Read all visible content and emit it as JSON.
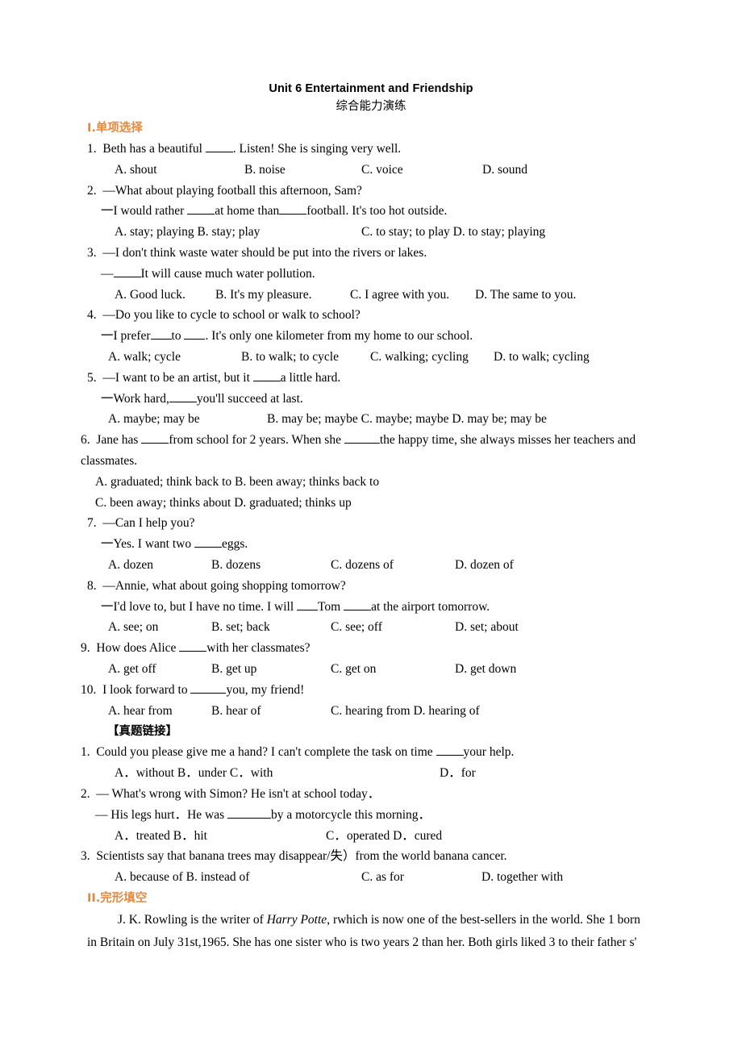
{
  "document": {
    "title": "Unit 6 Entertainment and Friendship",
    "subtitle": "综合能力演练",
    "accent_color": "#E8883A",
    "text_color": "#000000",
    "background": "#FFFFFF"
  },
  "sections": [
    {
      "id": "section-1",
      "numeral": "I.",
      "label": "单项选择",
      "heading_full": "I.单项选择"
    },
    {
      "id": "section-2",
      "numeral": "II.",
      "label": "完形填空",
      "heading_full": "II.完形填空"
    }
  ],
  "subheading": "【真题链接】",
  "multiple_choice": {
    "q1": {
      "number": "1.",
      "stem_1": "Beth has a beautiful ",
      "stem_2": ". Listen! She is singing very well.",
      "options": {
        "a": "A. shout",
        "b": "B. noise",
        "c": "C. voice",
        "d": "D. sound"
      }
    },
    "q2": {
      "number": "2.",
      "stem_1": "—What about playing football this afternoon, Sam?",
      "reply_1": "一I would rather ",
      "reply_2": "at home than",
      "reply_3": "football. It's too hot outside.",
      "options": {
        "ab": "A. stay; playing B. stay; play",
        "cd": "C. to stay; to play D. to stay; playing"
      }
    },
    "q3": {
      "number": "3.",
      "stem_1": "—I don't think waste water should be put into the rivers or lakes.",
      "reply_1": "—",
      "reply_2": "It will cause much water pollution.",
      "options": {
        "a": "A. Good luck.",
        "b": "B. It's my pleasure.",
        "c": "C. I agree with you.",
        "d": "D. The same to you."
      }
    },
    "q4": {
      "number": "4.",
      "stem_1": "—Do you like to cycle to school or walk to school?",
      "reply_1": "一I prefer",
      "reply_2": "to",
      "reply_3": ". It's only one kilometer from my home to our school.",
      "options": {
        "a": "A. walk; cycle",
        "b": "B. to walk; to cycle",
        "c": "C. walking; cycling",
        "d": "D. to walk; cycling"
      }
    },
    "q5": {
      "number": "5.",
      "stem_1": "—I want to be an artist, but it ",
      "stem_2": "a little hard.",
      "reply_1": "一Work hard,",
      "reply_2": "you'll succeed at last.",
      "options": {
        "a": "A. maybe; may be",
        "bcd": "B. may be; maybe C. maybe; maybe D. may be; may be"
      }
    },
    "q6": {
      "number": "6.",
      "stem_1": "Jane has ",
      "stem_2": "from school for 2 years. When she ",
      "stem_3": "the happy time, she always misses her teachers and classmates.",
      "options": {
        "ab": "A. graduated; think back to B. been away; thinks back to",
        "cd": "C. been away; thinks about D. graduated; thinks up"
      }
    },
    "q7": {
      "number": "7.",
      "stem_1": "—Can I help you?",
      "reply_1": "一Yes. I want two ",
      "reply_2": "eggs.",
      "options": {
        "a": "A. dozen",
        "b": "B. dozens",
        "c": "C. dozens of",
        "d": "D. dozen of"
      }
    },
    "q8": {
      "number": "8.",
      "stem_1": "—Annie, what about going shopping tomorrow?",
      "reply_1": "一I'd love to, but I have no time. I will ",
      "reply_2": "Tom ",
      "reply_3": "at the airport tomorrow.",
      "options": {
        "a": "A. see; on",
        "b": "B. set; back",
        "c": "C. see; off",
        "d": "D. set; about"
      }
    },
    "q9": {
      "number": "9.",
      "stem_1": "How does Alice ",
      "stem_2": "with her classmates?",
      "options": {
        "a": "A. get off",
        "b": "B. get up",
        "c": "C. get on",
        "d": "D. get down"
      }
    },
    "q10": {
      "number": "10.",
      "stem_1": "I look forward to ",
      "stem_2": "you, my friend!",
      "options": {
        "a": "A. hear from",
        "b": "B. hear of",
        "cd": "C. hearing from D. hearing of"
      }
    }
  },
  "exam_link": {
    "q1": {
      "number": "1.",
      "stem_1": "Could you please give me a hand? I can't complete the task on time ",
      "stem_2": "your help.",
      "options": {
        "abc": "A．without B．under C．with",
        "d": "D．for"
      }
    },
    "q2": {
      "number": "2.",
      "stem_1": "— What's wrong with Simon? He isn't at school today．",
      "reply_1": "— His legs hurt．He was ",
      "reply_2": "by a motorcycle this morning．",
      "options": {
        "ab": "A．treated B．hit",
        "cd": "C．operated D．cured"
      }
    },
    "q3": {
      "number": "3.",
      "stem_1": "Scientists say that banana trees may disappear/失）from the world banana cancer.",
      "options": {
        "ab": "A. because of B. instead of",
        "c": "C. as for",
        "d": "D. together with"
      }
    }
  },
  "cloze": {
    "line_1_pre": "J. K. Rowling is the writer of ",
    "line_1_italic": "Harry Potte",
    "line_1_post": ", rwhich is now one of the best-sellers in the world. She 1 born in Britain on July 31st,1965. She has one sister who is two years 2 than her. Both girls liked 3 to their father s'"
  }
}
